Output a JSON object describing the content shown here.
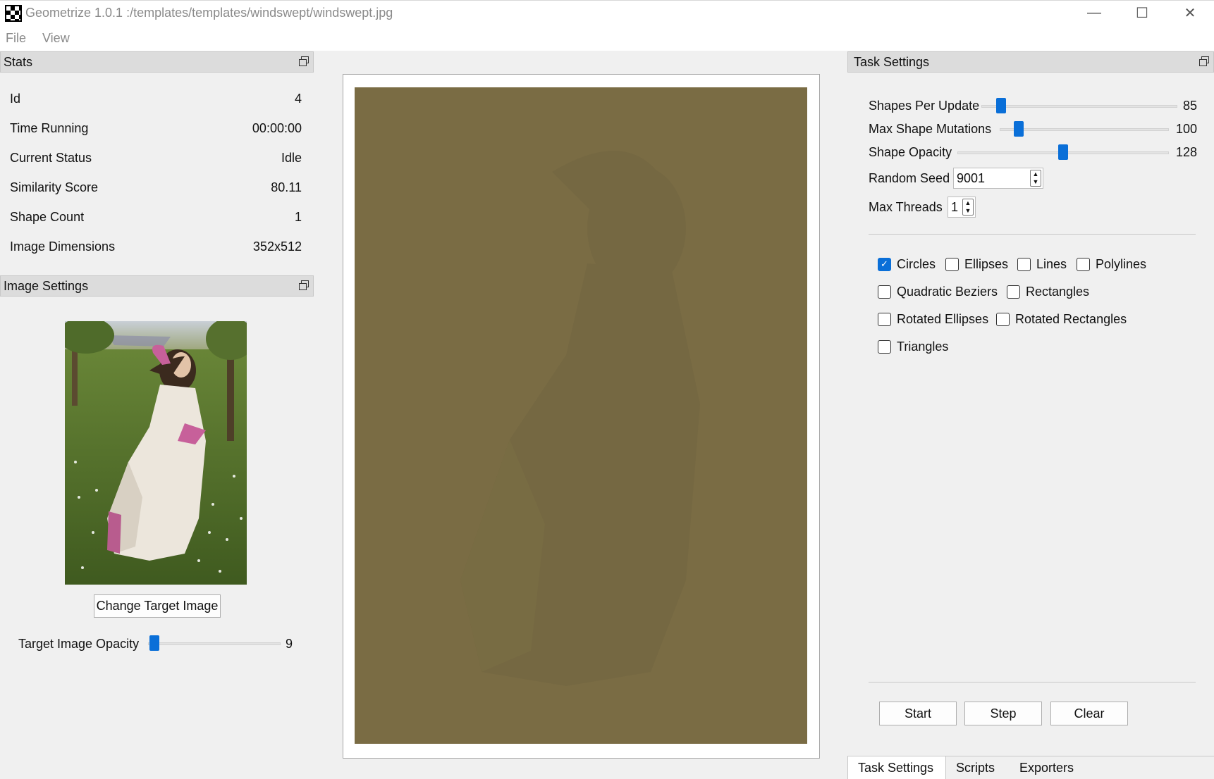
{
  "window": {
    "title": "Geometrize 1.0.1 :/templates/templates/windswept/windswept.jpg",
    "minimize_icon": "minimize-icon",
    "maximize_icon": "maximize-icon",
    "close_icon": "close-icon"
  },
  "menu": {
    "file": "File",
    "view": "View"
  },
  "stats": {
    "header": "Stats",
    "rows": [
      {
        "label": "Id",
        "value": "4"
      },
      {
        "label": "Time Running",
        "value": "00:00:00"
      },
      {
        "label": "Current Status",
        "value": "Idle"
      },
      {
        "label": "Similarity Score",
        "value": "80.11"
      },
      {
        "label": "Shape Count",
        "value": "1"
      },
      {
        "label": "Image Dimensions",
        "value": "352x512"
      }
    ]
  },
  "image_settings": {
    "header": "Image Settings",
    "change_button": "Change Target Image",
    "opacity_label": "Target Image Opacity",
    "opacity_value": "9",
    "opacity_level": 9,
    "opacity_max": 255
  },
  "task_settings": {
    "header": "Task Settings",
    "shapes_per_update": {
      "label": "Shapes Per Update",
      "value": "85",
      "level": 0.08
    },
    "max_shape_mutations": {
      "label": "Max Shape Mutations",
      "value": "100",
      "level": 0.09
    },
    "shape_opacity": {
      "label": "Shape Opacity",
      "value": "128",
      "level": 0.5
    },
    "random_seed": {
      "label": "Random Seed",
      "value": "9001"
    },
    "max_threads": {
      "label": "Max Threads",
      "value": "1"
    },
    "shapes": {
      "circles": {
        "label": "Circles",
        "checked": true
      },
      "ellipses": {
        "label": "Ellipses",
        "checked": false
      },
      "lines": {
        "label": "Lines",
        "checked": false
      },
      "polylines": {
        "label": "Polylines",
        "checked": false
      },
      "quadratic_beziers": {
        "label": "Quadratic Beziers",
        "checked": false
      },
      "rectangles": {
        "label": "Rectangles",
        "checked": false
      },
      "rotated_ellipses": {
        "label": "Rotated Ellipses",
        "checked": false
      },
      "rotated_rectangles": {
        "label": "Rotated Rectangles",
        "checked": false
      },
      "triangles": {
        "label": "Triangles",
        "checked": false
      }
    },
    "buttons": {
      "start": "Start",
      "step": "Step",
      "clear": "Clear"
    }
  },
  "tabs": [
    "Task Settings",
    "Scripts",
    "Exporters"
  ],
  "colors": {
    "accent": "#0a6fd8",
    "canvas_fill": "#7a6c44"
  }
}
